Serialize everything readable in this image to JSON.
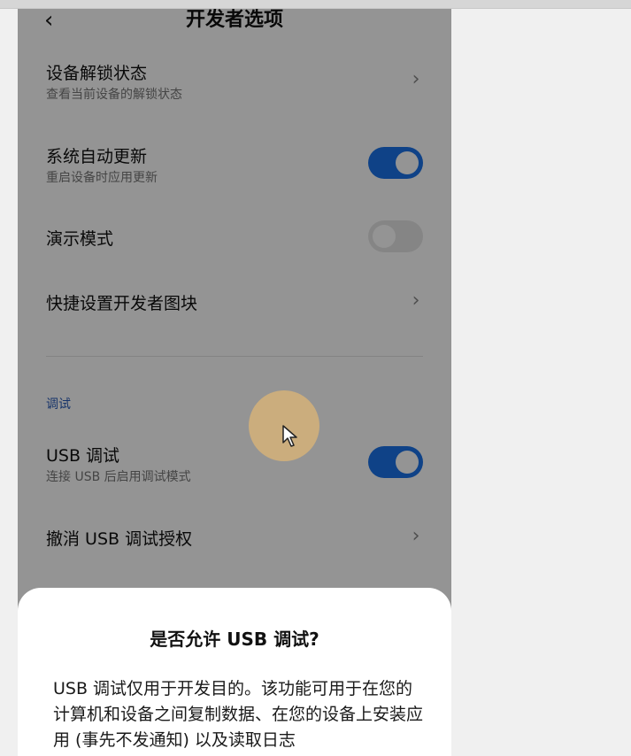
{
  "header": {
    "title": "开发者选项"
  },
  "settings": {
    "unlock": {
      "title": "设备解锁状态",
      "subtitle": "查看当前设备的解锁状态"
    },
    "auto_update": {
      "title": "系统自动更新",
      "subtitle": "重启设备时应用更新",
      "enabled": true
    },
    "demo": {
      "title": "演示模式",
      "enabled": false
    },
    "qs_tiles": {
      "title": "快捷设置开发者图块"
    },
    "section_debug": "调试",
    "usb_debug": {
      "title": "USB 调试",
      "subtitle": "连接 USB 后启用调试模式",
      "enabled": true
    },
    "revoke": {
      "title": "撤消 USB 调试授权"
    }
  },
  "dialog": {
    "title": "是否允许 USB 调试?",
    "body": "USB 调试仅用于开发目的。该功能可用于在您的计算机和设备之间复制数据、在您的设备上安装应用 (事先不发通知) 以及读取日志"
  },
  "colors": {
    "accent": "#1a73e8",
    "section": "#2a5cb8"
  }
}
